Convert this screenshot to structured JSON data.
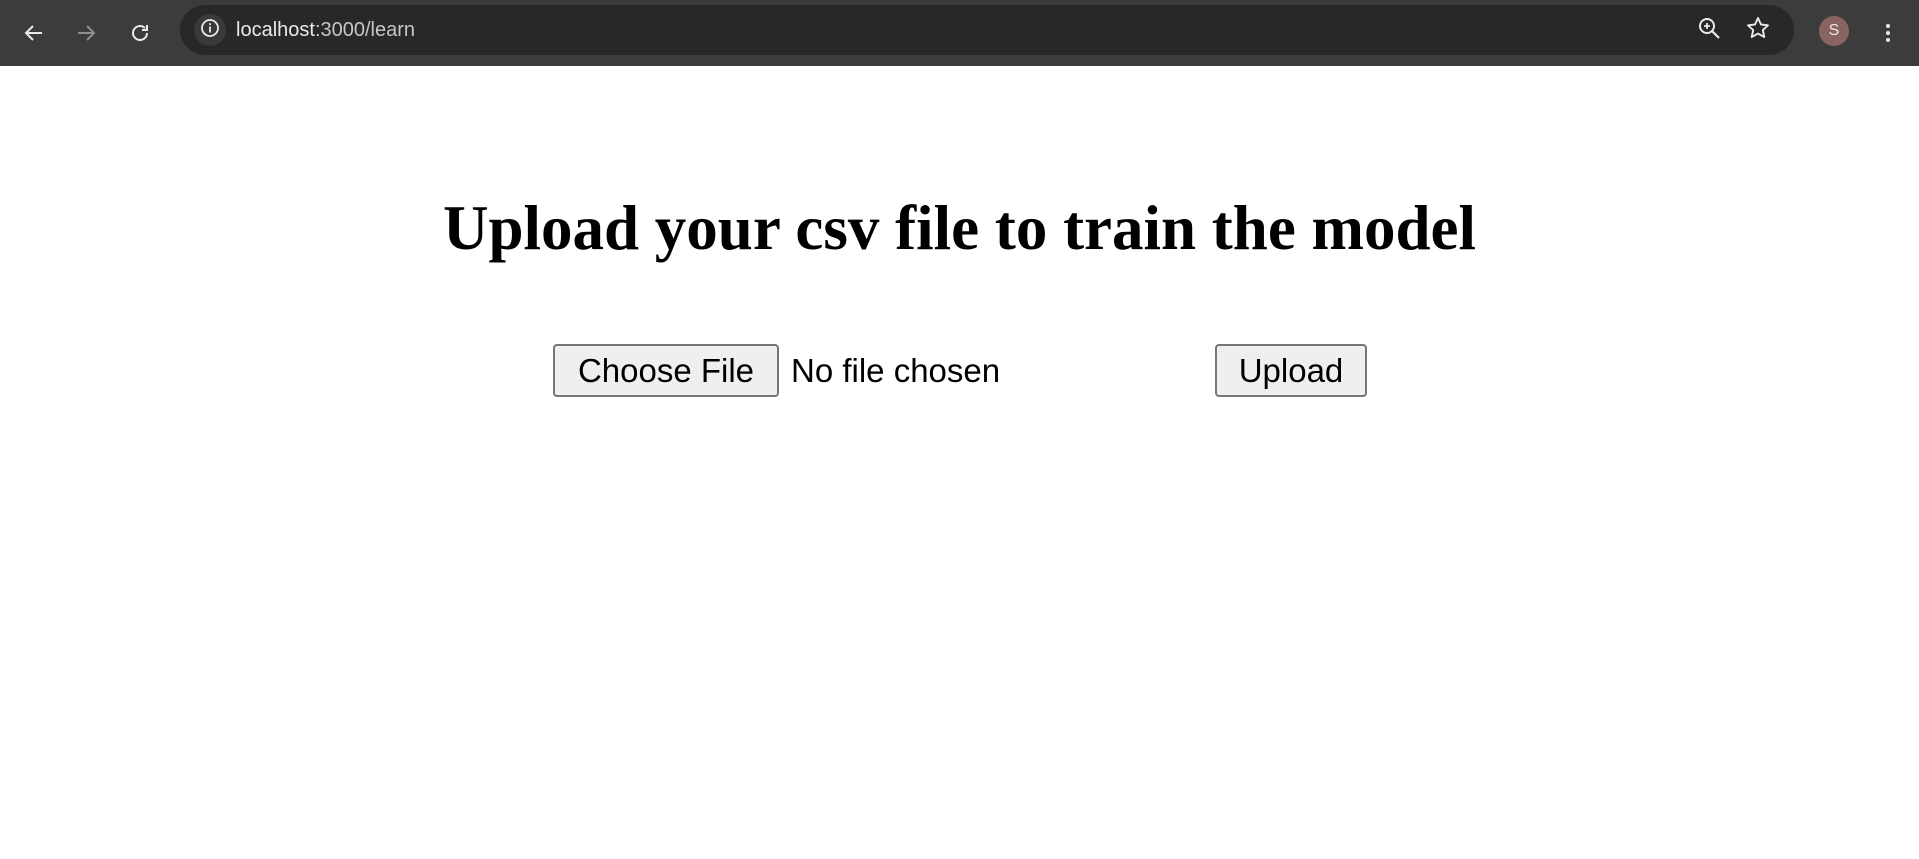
{
  "browser": {
    "url_host": "localhost",
    "url_path": ":3000/learn",
    "profile_initial": "S",
    "icons": {
      "back": "arrow-left-icon",
      "forward": "arrow-right-icon",
      "reload": "reload-icon",
      "site_info": "info-icon",
      "zoom": "zoom-icon",
      "bookmark": "star-icon",
      "menu": "kebab-menu-icon"
    },
    "colors": {
      "toolbar": "#3c3c3c",
      "omnibox": "#282828",
      "avatar": "#8a6460"
    }
  },
  "page": {
    "title": "Upload your csv file to train the model",
    "file_input": {
      "button_label": "Choose File",
      "status": "No file chosen"
    },
    "upload_button": "Upload"
  }
}
